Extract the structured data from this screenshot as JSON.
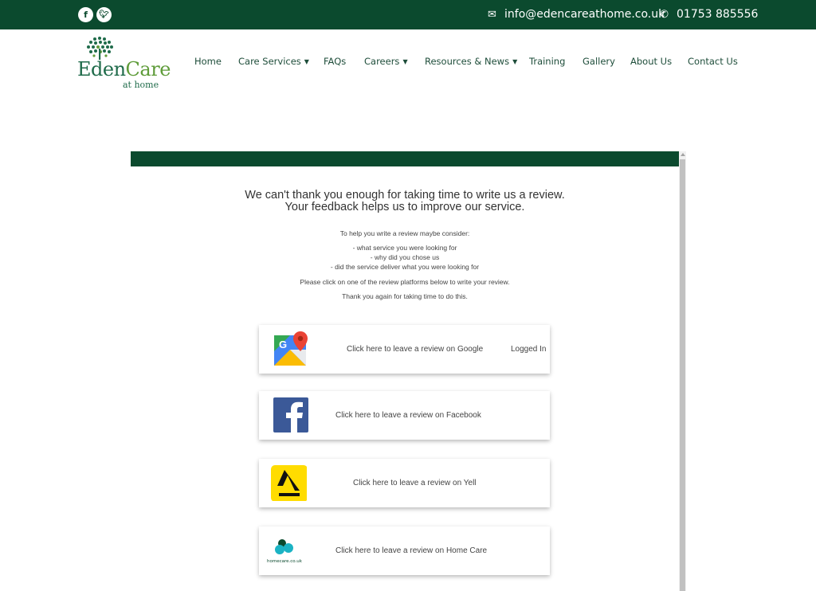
{
  "topbar": {
    "email": "info@edencareathome.co.uk",
    "phone": "01753 885556",
    "social_icons": [
      "facebook-icon",
      "twitter-icon"
    ],
    "email_icon": "envelope-icon",
    "phone_icon": "phone-icon"
  },
  "logo": {
    "eden": "Eden",
    "care": "Care",
    "sub": "at home"
  },
  "nav": {
    "items": [
      {
        "label": "Home",
        "dropdown": false
      },
      {
        "label": "Care Services",
        "dropdown": true
      },
      {
        "label": "FAQs",
        "dropdown": false
      },
      {
        "label": "Careers",
        "dropdown": true
      },
      {
        "label": "Resources & News",
        "dropdown": true
      },
      {
        "label": "Training",
        "dropdown": false
      },
      {
        "label": "Gallery",
        "dropdown": false
      },
      {
        "label": "About Us",
        "dropdown": false
      },
      {
        "label": "Contact Us",
        "dropdown": false
      }
    ]
  },
  "review": {
    "heading_line1": "We can't thank you enough for taking time to write us a review.",
    "heading_line2": "Your feedback helps us to improve our service.",
    "consider_intro": "To help you write a review maybe consider:",
    "consider_items": [
      "- what service you were looking for",
      "- why did you chose us",
      "- did the service deliver what you were looking for"
    ],
    "instruction": "Please click on one of the review platforms below to write your review.",
    "thanks": "Thank you again for taking time to do this.",
    "platforms": [
      {
        "label": "Click here to leave a review on Google",
        "extra": "Logged In",
        "icon": "google-maps-icon"
      },
      {
        "label": "Click here to leave a review on Facebook",
        "icon": "facebook-icon"
      },
      {
        "label": "Click here to leave a review on Yell",
        "icon": "yell-icon"
      },
      {
        "label": "Click here to leave a review on Home Care",
        "icon": "homecare-icon",
        "icon_text": "homecare.co.uk"
      }
    ]
  },
  "colors": {
    "brand_green": "#0b4a2e",
    "nav_text": "#1e4d3a",
    "logo_green": "#1f6b4a",
    "logo_light_green": "#5f9c3a"
  }
}
